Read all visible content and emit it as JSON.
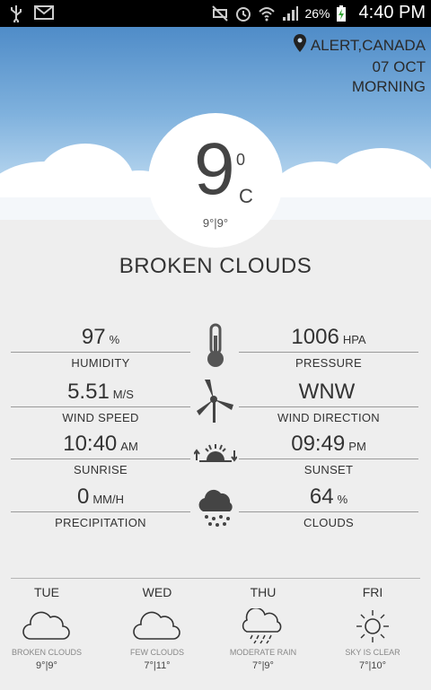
{
  "status_bar": {
    "battery": "26%",
    "time": "4:40 PM"
  },
  "location": {
    "city": "ALERT,CANADA",
    "date": "07 OCT",
    "period": "MORNING"
  },
  "current": {
    "temp": "9",
    "temp_sup": "0",
    "unit": "C",
    "range": "9°|9°",
    "condition": "BROKEN CLOUDS"
  },
  "details": [
    {
      "left_value": "97",
      "left_unit": "%",
      "left_label": "HUMIDITY",
      "icon": "thermometer-icon",
      "right_value": "1006",
      "right_unit": "HPA",
      "right_label": "PRESSURE"
    },
    {
      "left_value": "5.51",
      "left_unit": "M/S",
      "left_label": "WIND SPEED",
      "icon": "wind-turbine-icon",
      "right_value": "WNW",
      "right_unit": "",
      "right_label": "WIND DIRECTION"
    },
    {
      "left_value": "10:40",
      "left_unit": "AM",
      "left_label": "SUNRISE",
      "icon": "sunrise-sunset-icon",
      "right_value": "09:49",
      "right_unit": "PM",
      "right_label": "SUNSET"
    },
    {
      "left_value": "0",
      "left_unit": "MM/H",
      "left_label": "PRECIPITATION",
      "icon": "rain-cloud-icon",
      "right_value": "64",
      "right_unit": "%",
      "right_label": "CLOUDS"
    }
  ],
  "forecast": [
    {
      "day": "TUE",
      "icon": "cloud-icon",
      "desc": "BROKEN CLOUDS",
      "range": "9°|9°"
    },
    {
      "day": "WED",
      "icon": "cloud-icon",
      "desc": "FEW CLOUDS",
      "range": "7°|11°"
    },
    {
      "day": "THU",
      "icon": "rain-cloud-icon",
      "desc": "MODERATE RAIN",
      "range": "7°|9°"
    },
    {
      "day": "FRI",
      "icon": "sun-icon",
      "desc": "SKY IS CLEAR",
      "range": "7°|10°"
    }
  ]
}
